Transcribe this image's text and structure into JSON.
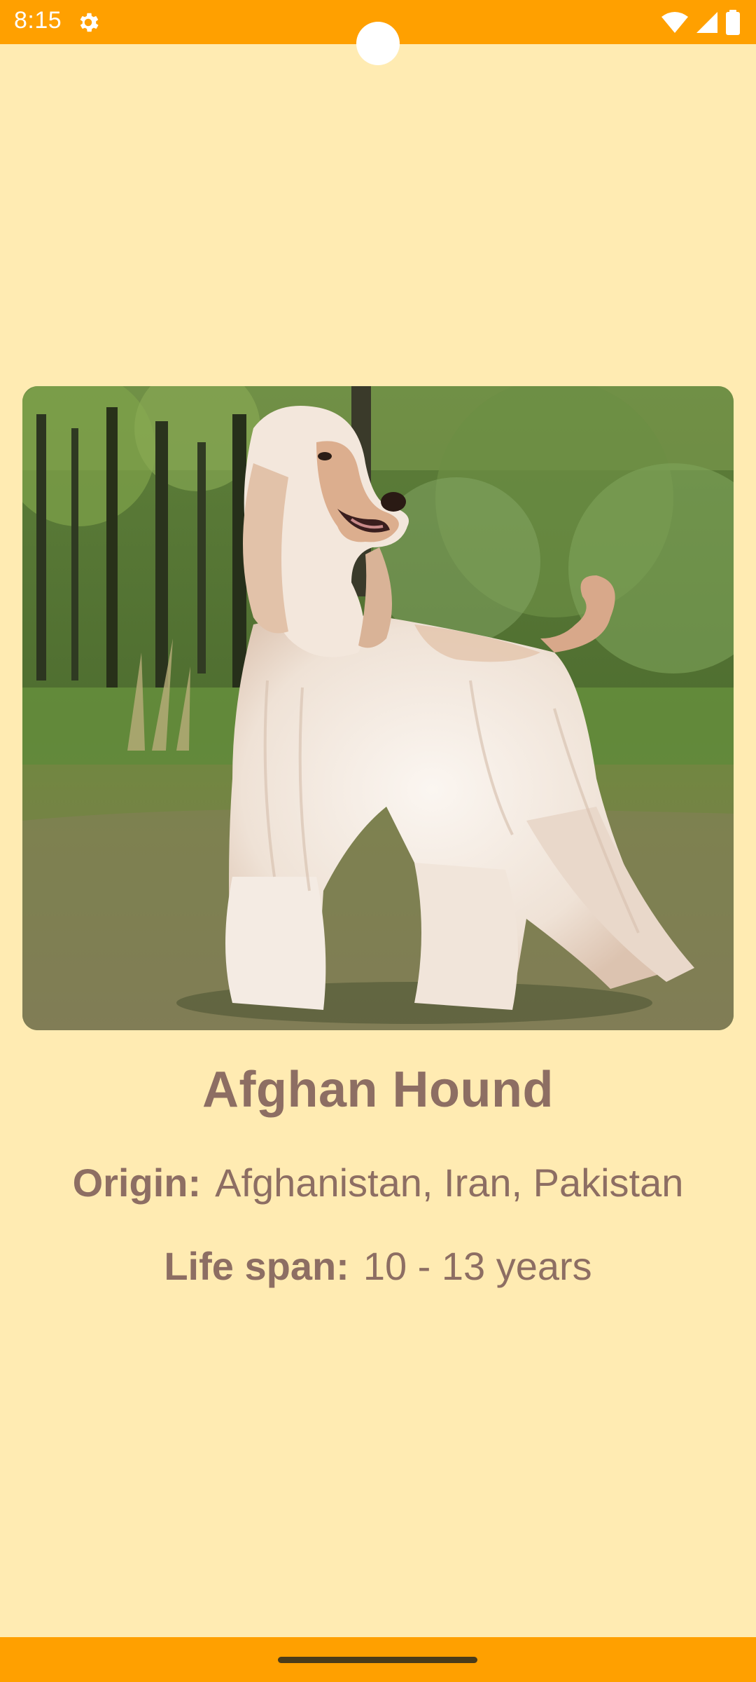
{
  "status_bar": {
    "time": "8:15",
    "icons": [
      "gear-icon",
      "wifi-icon",
      "signal-icon",
      "battery-icon"
    ],
    "color": "#FFA000"
  },
  "breed": {
    "name": "Afghan Hound",
    "image_subject": "dog-photo",
    "origin_label": "Origin:",
    "origin_value": "Afghanistan, Iran, Pakistan",
    "life_span_label": "Life span:",
    "life_span_value": "10 - 13 years"
  },
  "theme": {
    "background": "#FFEBB2",
    "bars": "#FFA000",
    "text": "#8D6E63"
  }
}
